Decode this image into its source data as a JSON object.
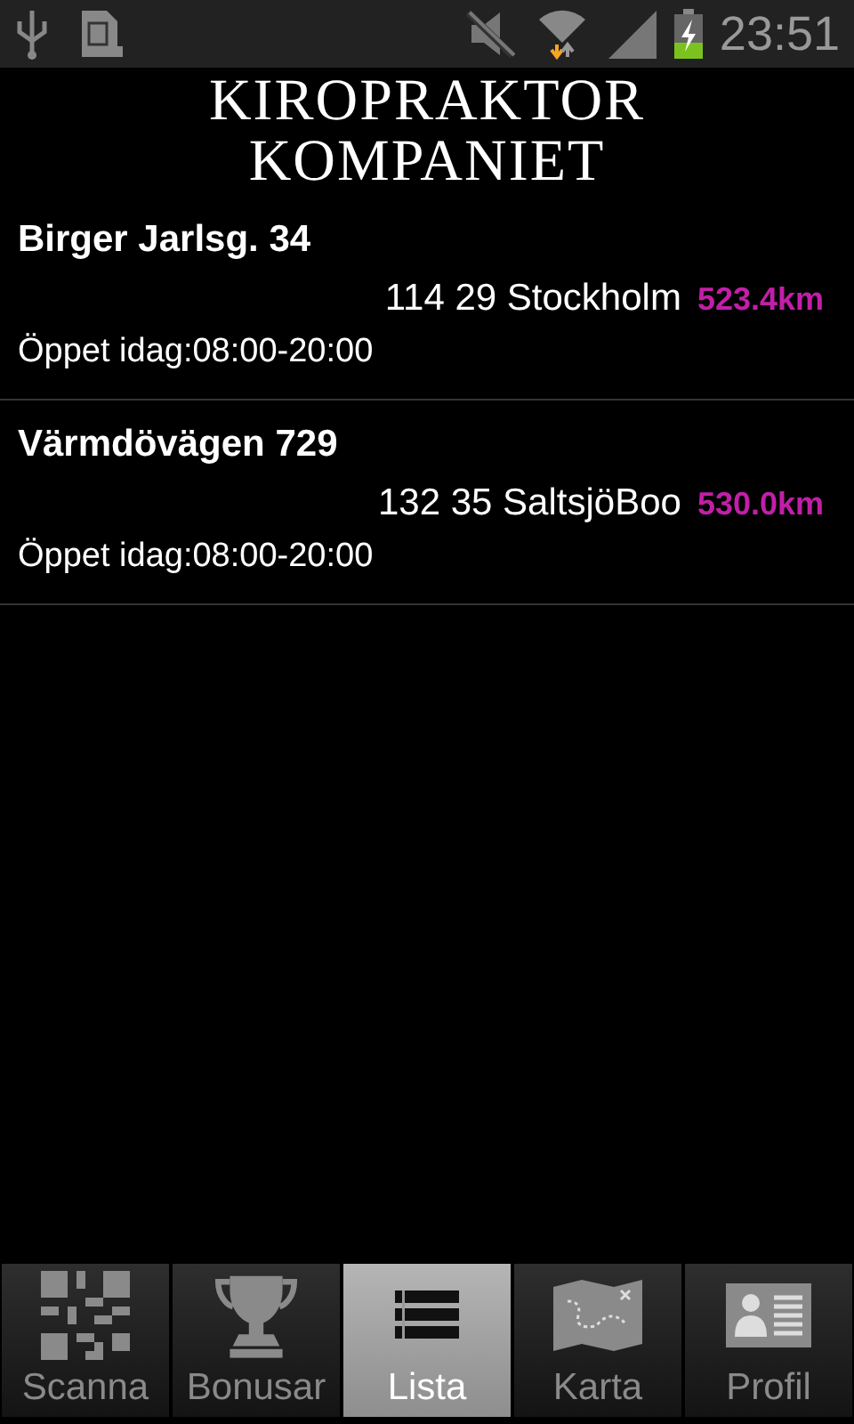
{
  "status_bar": {
    "time": "23:51"
  },
  "header": {
    "logo_lines": [
      "KIROPRAKTOR",
      "KOMPANIET"
    ]
  },
  "locations": [
    {
      "street": "Birger Jarlsg. 34",
      "city": "114 29 Stockholm",
      "distance": "523.4km",
      "hours": "Öppet idag:08:00-20:00"
    },
    {
      "street": "Värmdövägen 729",
      "city": "132 35 SaltsjöBoo",
      "distance": "530.0km",
      "hours": "Öppet idag:08:00-20:00"
    }
  ],
  "tabs": [
    {
      "label": "Scanna",
      "selected": false
    },
    {
      "label": "Bonusar",
      "selected": false
    },
    {
      "label": "Lista",
      "selected": true
    },
    {
      "label": "Karta",
      "selected": false
    },
    {
      "label": "Profil",
      "selected": false
    }
  ]
}
